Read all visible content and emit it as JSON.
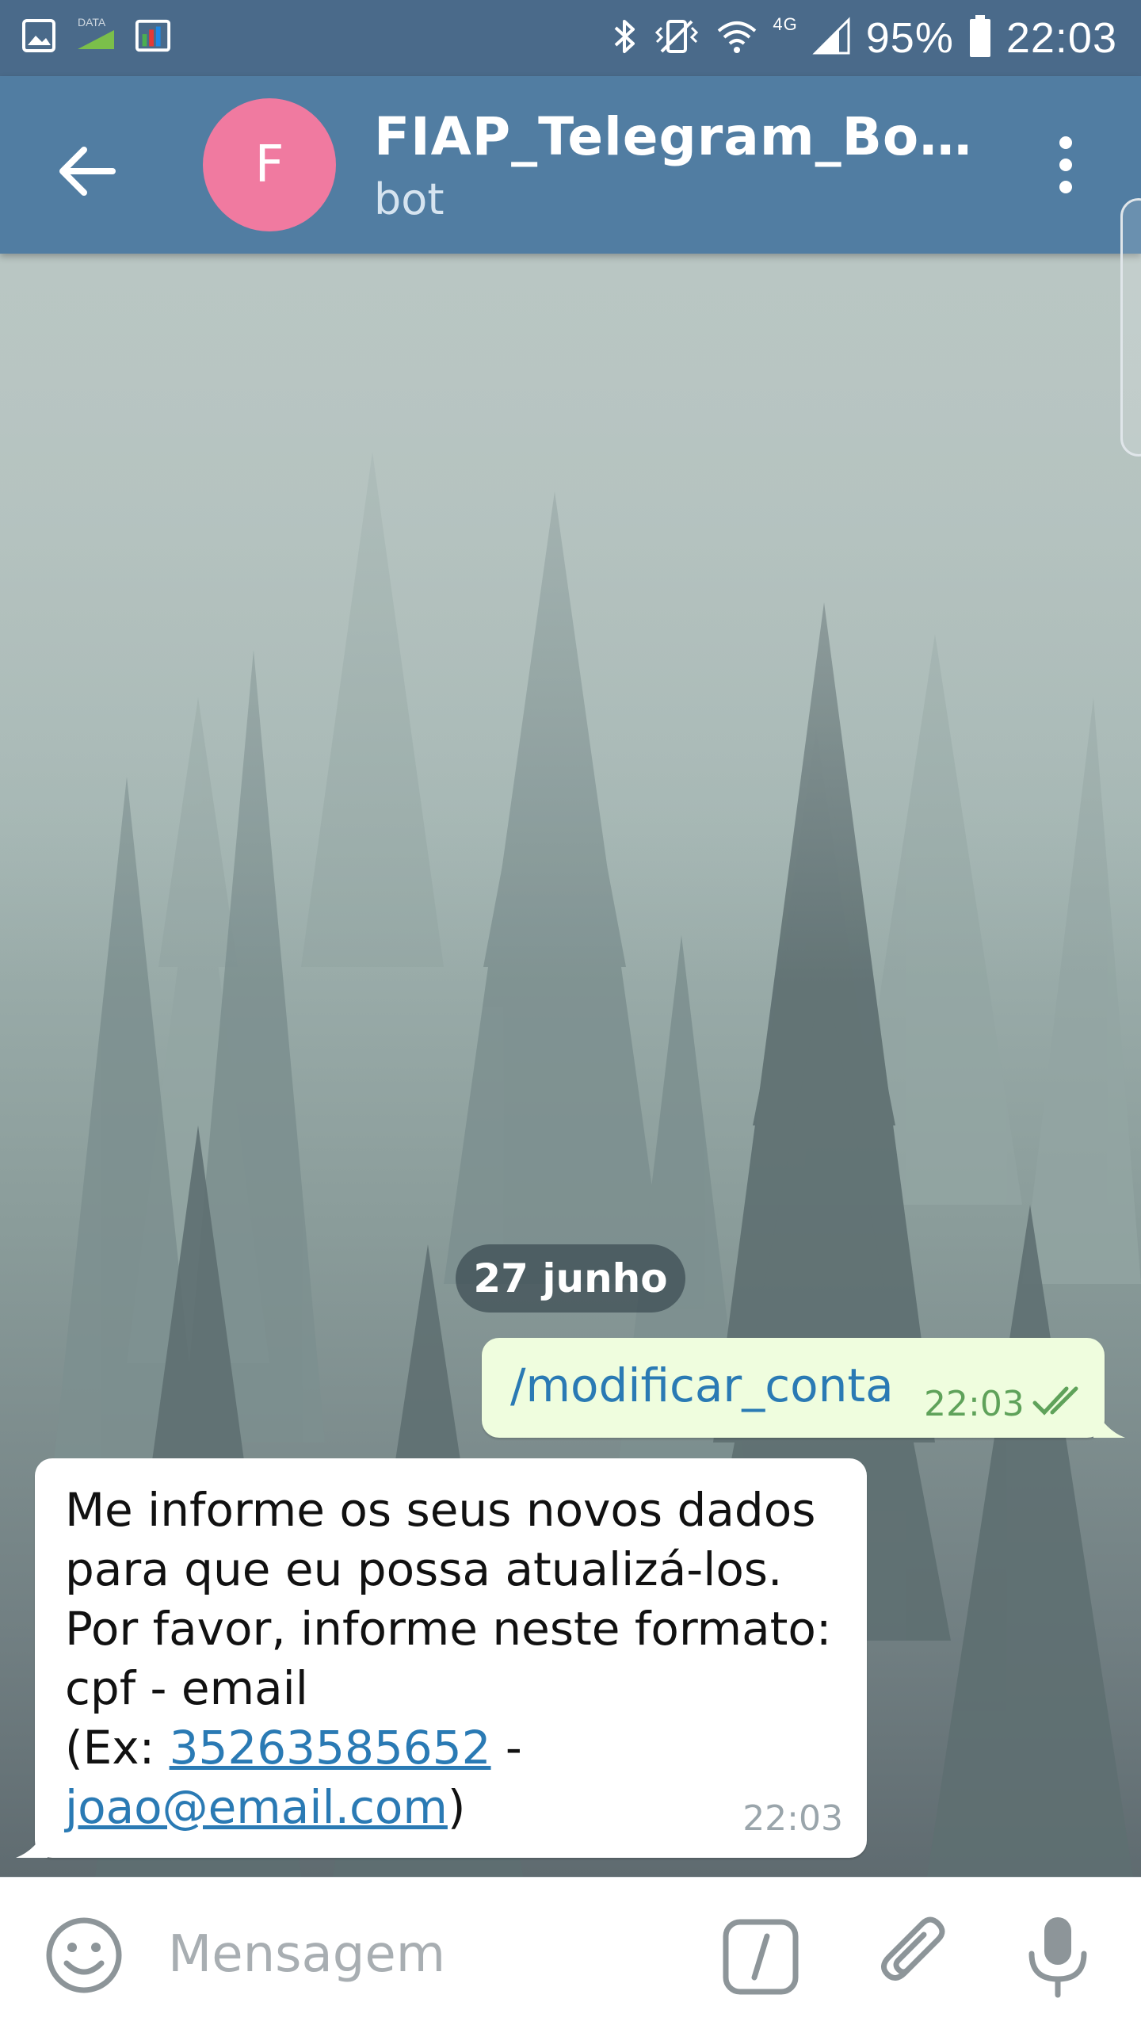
{
  "status_bar": {
    "battery": "95%",
    "time": "22:03",
    "network": "4G",
    "data_label": "DATA",
    "left_icons": [
      "gallery-icon",
      "data-icon",
      "monitor-icon"
    ],
    "right_icons": [
      "bluetooth-icon",
      "vibrate-icon",
      "wifi-icon",
      "signal-icon",
      "battery-icon"
    ]
  },
  "header": {
    "avatar_letter": "F",
    "title": "FIAP_Telegram_Bot_D…",
    "subtitle": "bot",
    "avatar_color": "#f07aa0",
    "bar_color": "#517da2"
  },
  "chat": {
    "date_label": "27 junho",
    "messages": [
      {
        "direction": "out",
        "text": "/modificar_conta",
        "time": "22:03",
        "status": "read"
      },
      {
        "direction": "in",
        "lines": [
          "Me informe os seus novos dados",
          "para que eu possa atualizá-los.",
          "Por favor, informe neste formato:",
          "cpf - email"
        ],
        "example_prefix": "(Ex: ",
        "example_cpf": "35263585652",
        "example_separator": " -",
        "example_email": "joao@email.com",
        "example_suffix": ")",
        "time": "22:03"
      }
    ]
  },
  "input": {
    "placeholder": "Mensagem",
    "icons": [
      "emoji-icon",
      "bot-command-icon",
      "attach-icon",
      "microphone-icon"
    ]
  },
  "colors": {
    "outgoing_bubble": "#effdde",
    "incoming_bubble": "#ffffff",
    "link": "#2a7ab4",
    "outgoing_time": "#5fa25a"
  }
}
